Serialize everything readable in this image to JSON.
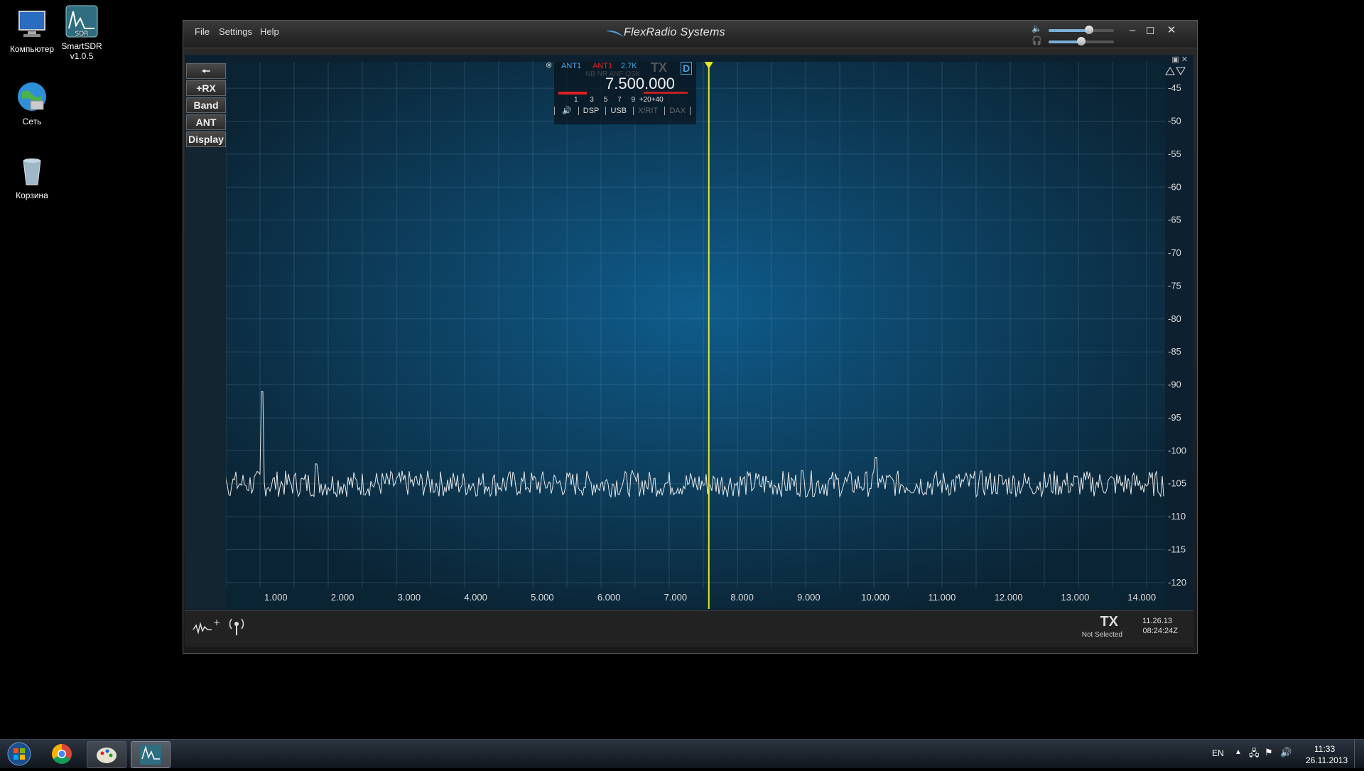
{
  "desktop": {
    "icons": [
      {
        "label": "Компьютер"
      },
      {
        "label": "SmartSDR",
        "label2": "v1.0.5"
      },
      {
        "label": "Сеть"
      },
      {
        "label": "Корзина"
      }
    ]
  },
  "window": {
    "menu": [
      "File",
      "Settings",
      "Help"
    ],
    "brand": "FlexRadio Systems",
    "volume_level": 0.62,
    "headphone_level": 0.5
  },
  "side_buttons": [
    "+RX",
    "Band",
    "ANT",
    "Display"
  ],
  "slice": {
    "rx_ant": "ANT1",
    "tx_ant": "ANT1",
    "filter": "2.7K",
    "tx": "TX",
    "letter": "D",
    "dsp_flags": "NB NR ANF QSK",
    "frequency": "7.500.000",
    "meter_scale": [
      "1",
      "3",
      "5",
      "7",
      "9",
      "+20",
      "+40"
    ],
    "buttons": [
      "DSP",
      "USB",
      "X/RIT",
      "DAX"
    ],
    "colors": {
      "rx_ant": "#4aa3e0",
      "tx_ant": "#e02020",
      "cursor": "#e6e623"
    }
  },
  "spectrum": {
    "db_scale": [
      "-45",
      "-50",
      "-55",
      "-60",
      "-65",
      "-70",
      "-75",
      "-80",
      "-85",
      "-90",
      "-95",
      "-100",
      "-105",
      "-110",
      "-115",
      "-120"
    ],
    "freq_scale": [
      "1.000",
      "2.000",
      "3.000",
      "4.000",
      "5.000",
      "6.000",
      "7.000",
      "8.000",
      "9.000",
      "10.000",
      "11.000",
      "12.000",
      "13.000",
      "14.000"
    ],
    "noise_floor_db": -105,
    "peaks": [
      {
        "mhz": 0.01,
        "db": -91
      },
      {
        "mhz": 0.8,
        "db": -91
      },
      {
        "mhz": 1.6,
        "db": -102
      },
      {
        "mhz": 10.0,
        "db": -101
      },
      {
        "mhz": 8.9,
        "db": -103
      }
    ],
    "cursor_mhz": 7.5,
    "span_mhz": [
      0.25,
      14.35
    ]
  },
  "footer": {
    "tx": "TX",
    "tx_status": "Not Selected",
    "date": "11.26.13",
    "time": "08:24:24Z"
  },
  "taskbar": {
    "lang": "EN",
    "clock_time": "11:33",
    "clock_date": "26.11.2013"
  }
}
